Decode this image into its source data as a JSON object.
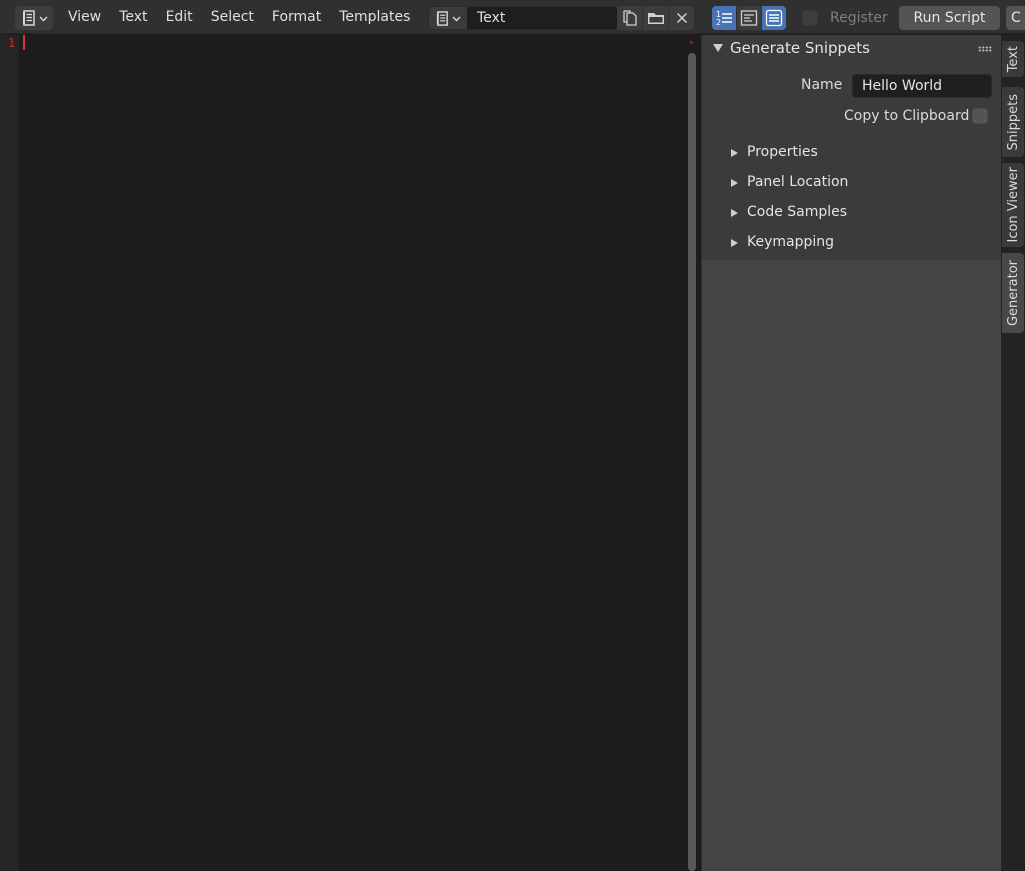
{
  "header": {
    "editor_type_icon": "text-editor-icon",
    "menu": [
      "View",
      "Text",
      "Edit",
      "Select",
      "Format",
      "Templates"
    ],
    "text_datablock": "Text",
    "register_label": "Register",
    "run_script_label": "Run Script",
    "cut_button_label": "C"
  },
  "editor": {
    "line_numbers": [
      "1"
    ],
    "content": ""
  },
  "sidebar": {
    "panel_title": "Generate Snippets",
    "name_label": "Name",
    "name_value": "Hello World",
    "copy_label": "Copy to Clipboard",
    "subpanels": [
      "Properties",
      "Panel Location",
      "Code Samples",
      "Keymapping"
    ]
  },
  "tabs": [
    "Text",
    "Snippets",
    "Icon Viewer",
    "Generator"
  ],
  "colors": {
    "accent": "#4772b3",
    "cursor": "#e03030"
  }
}
